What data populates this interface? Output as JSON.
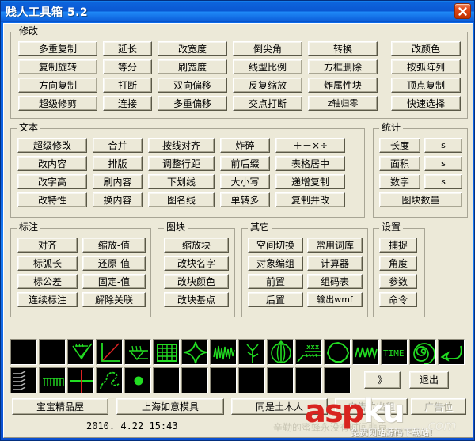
{
  "window": {
    "title": "贱人工具箱 5.2",
    "close_label": "×"
  },
  "groups": {
    "modify": {
      "legend": "修改",
      "columns": [
        [
          "多重复制",
          "复制旋转",
          "方向复制",
          "超级修剪"
        ],
        [
          "延长",
          "等分",
          "打断",
          "连接"
        ],
        [
          "改宽度",
          "刷宽度",
          "双向偏移",
          "多重偏移"
        ],
        [
          "倒尖角",
          "线型比例",
          "反复缩放",
          "交点打断"
        ],
        [
          "转换",
          "方框删除",
          "炸属性块",
          "z轴归零"
        ],
        [
          "改颜色",
          "按弧阵列",
          "顶点复制",
          "快速选择"
        ]
      ]
    },
    "text": {
      "legend": "文本",
      "columns": [
        [
          "超级修改",
          "改内容",
          "改字高",
          "改特性"
        ],
        [
          "合并",
          "排版",
          "刷内容",
          "换内容"
        ],
        [
          "按线对齐",
          "调整行距",
          "下划线",
          "图名线"
        ],
        [
          "炸碎",
          "前后缀",
          "大小写",
          "单转多"
        ],
        [
          "＋－×÷",
          "表格居中",
          "递增复制",
          "复制并改"
        ]
      ]
    },
    "statistics": {
      "legend": "统计",
      "rows": [
        {
          "label": "长度",
          "unit": "s"
        },
        {
          "label": "面积",
          "unit": "s"
        },
        {
          "label": "数字",
          "unit": "s"
        }
      ],
      "wide_button": "图块数量"
    },
    "dimension": {
      "legend": "标注",
      "columns": [
        [
          "对齐",
          "标弧长",
          "标公差",
          "连续标注"
        ],
        [
          "缩放-值",
          "还原-值",
          "固定-值",
          "解除关联"
        ]
      ]
    },
    "block": {
      "legend": "图块",
      "columns": [
        [
          "缩放块",
          "改块名字",
          "改块颜色",
          "改块基点"
        ]
      ]
    },
    "other": {
      "legend": "其它",
      "columns": [
        [
          "空间切换",
          "对象编组",
          "前置",
          "后置"
        ],
        [
          "常用词库",
          "计算器",
          "组码表",
          "输出wmf"
        ]
      ]
    },
    "settings": {
      "legend": "设置",
      "buttons": [
        "捕捉",
        "角度",
        "参数",
        "命令"
      ]
    }
  },
  "icon_grid": {
    "row1": [
      "blank-icon",
      "blank-icon",
      "slope-arrow-icon",
      "angle-axis-icon",
      "hatch-arrow-icon",
      "table-grid-icon",
      "four-point-star-icon",
      "scribble-icon",
      "tree-branch-icon",
      "antenna-icon",
      "xxx-line-icon",
      "polygon-cloud-icon",
      "wave-icon",
      "time-icon",
      "spiral-icon",
      "swoosh-arrow-icon"
    ],
    "row2": [
      "leader-lines-icon",
      "comb-hatch-icon",
      "crosshair-icon",
      "squiggle-path-icon",
      "dot-icon",
      "blank-icon",
      "blank-icon",
      "blank-icon",
      "blank-icon",
      "blank-icon",
      "blank-icon",
      "blank-icon"
    ]
  },
  "toolbar": {
    "more_label": "》",
    "exit_label": "退出"
  },
  "links": {
    "buttons": [
      {
        "label": "宝宝精品屋",
        "disabled": false
      },
      {
        "label": "上海如意模具",
        "disabled": false
      },
      {
        "label": "同是土木人",
        "disabled": false
      },
      {
        "label": "广告位出租",
        "disabled": true
      },
      {
        "label": "广告位",
        "disabled": true
      }
    ]
  },
  "status": {
    "datetime": "2010. 4.22   15:43",
    "hint": "辛勤的蜜蜂永没有时间悲哀"
  },
  "watermark": {
    "part1": "asp",
    "part2": "ku",
    "domain": ".com",
    "subtitle": "免费网站源码下载站!"
  },
  "colors": {
    "titlebar": "#0d5fe0",
    "client": "#ece9d8",
    "icon_green": "#22dd22",
    "icon_bg": "#000000",
    "watermark_red": "#d8241f"
  }
}
